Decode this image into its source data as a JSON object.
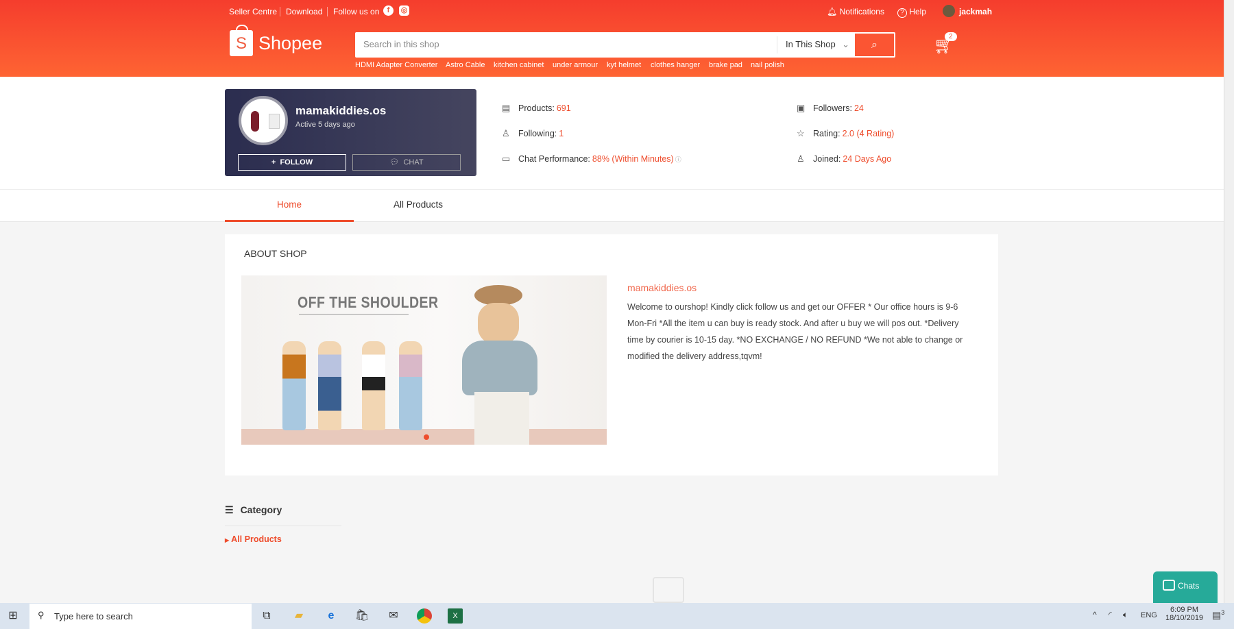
{
  "topbar": {
    "seller_centre": "Seller Centre",
    "download": "Download",
    "follow_us": "Follow us on",
    "notifications": "Notifications",
    "help": "Help",
    "username": "jackmah"
  },
  "logo": {
    "text": "Shopee",
    "letter": "S"
  },
  "search": {
    "placeholder": "Search in this shop",
    "scope": "In This Shop",
    "suggestions": [
      "HDMI Adapter Converter",
      "Astro Cable",
      "kitchen cabinet",
      "under armour",
      "kyt helmet",
      "clothes hanger",
      "brake pad",
      "nail polish"
    ]
  },
  "cart": {
    "count": "2"
  },
  "shop": {
    "name": "mamakiddies.os",
    "active": "Active 5 days ago",
    "follow": "FOLLOW",
    "chat": "CHAT"
  },
  "stats": {
    "products_label": "Products:",
    "products": "691",
    "following_label": "Following:",
    "following": "1",
    "chat_label": "Chat Performance:",
    "chat": "88% (Within Minutes)",
    "followers_label": "Followers:",
    "followers": "24",
    "rating_label": "Rating:",
    "rating": "2.0 (4 Rating)",
    "joined_label": "Joined:",
    "joined": "24 Days Ago"
  },
  "tabs": {
    "home": "Home",
    "all_products": "All Products"
  },
  "about": {
    "title": "ABOUT SHOP",
    "shop_name": "mamakiddies.os",
    "banner_text": "OFF THE SHOULDER",
    "description": "Welcome to ourshop! Kindly click follow us and get our OFFER * Our office hours is 9-6 Mon-Fri *All the item u can buy is ready stock. And after u buy we will pos out. *Delivery time by courier is 10-15 day. *NO EXCHANGE / NO REFUND *We not able to change or modified the delivery address,tqvm!"
  },
  "category": {
    "title": "Category",
    "items": [
      "All Products"
    ]
  },
  "chat_widget": {
    "label": "Chats"
  },
  "taskbar": {
    "search_placeholder": "Type here to search",
    "lang": "ENG",
    "time": "6:09 PM",
    "date": "18/10/2019",
    "notif_count": "3"
  },
  "colors": {
    "brand": "#ee4d2d",
    "chat": "#26aa99"
  }
}
